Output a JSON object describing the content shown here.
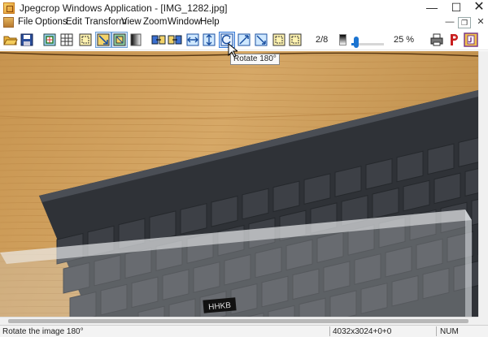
{
  "window": {
    "title": "Jpegcrop Windows Application - [IMG_1282.jpg]",
    "minimize_glyph": "—",
    "maximize_glyph": "☐",
    "close_glyph": "✕"
  },
  "menu": {
    "items": [
      "File",
      "Options",
      "Edit",
      "Transform",
      "View",
      "Zoom",
      "Window",
      "Help"
    ],
    "mdi_minimize_glyph": "—",
    "mdi_restore_glyph": "❐",
    "mdi_close_glyph": "✕"
  },
  "toolbar": {
    "buttons": [
      {
        "icon": "open-folder-icon",
        "pressed": false
      },
      {
        "icon": "save-icon",
        "pressed": false
      },
      {
        "icon": "crop-icon",
        "pressed": false
      },
      {
        "icon": "grid-icon",
        "pressed": false
      },
      {
        "icon": "select-icon",
        "pressed": false
      },
      {
        "icon": "fit-icon",
        "pressed": true
      },
      {
        "icon": "fit-alt-icon",
        "pressed": true
      },
      {
        "icon": "gradient-icon",
        "pressed": false
      },
      {
        "icon": "transform-icon",
        "pressed": false
      },
      {
        "icon": "transform-alt-icon",
        "pressed": false
      },
      {
        "icon": "flip-horizontal-icon",
        "pressed": false
      },
      {
        "icon": "flip-vertical-icon",
        "pressed": false
      },
      {
        "icon": "rotate-180-icon",
        "pressed": false,
        "hover": true
      },
      {
        "icon": "rotate-90-icon",
        "pressed": false
      },
      {
        "icon": "transpose-icon",
        "pressed": false
      },
      {
        "icon": "marquee-icon",
        "pressed": false
      },
      {
        "icon": "marquee-alt-icon",
        "pressed": false
      },
      {
        "icon": "print-icon",
        "pressed": false
      },
      {
        "icon": "p-letter-icon",
        "pressed": false
      },
      {
        "icon": "about-icon",
        "pressed": false
      }
    ],
    "page_indicator": "2/8",
    "zoom_label": "25 %",
    "zoom_level": 0.08,
    "tooltip": "Rotate 180°"
  },
  "image": {
    "filename": "IMG_1282.jpg",
    "description_alt": "photo",
    "case_label": "HHKB"
  },
  "status": {
    "message": "Rotate the image 180°",
    "dimensions": "4032x3024+0+0",
    "num_lock": "NUM"
  },
  "colors": {
    "accent": "#1b74d1",
    "wood": "#c99a56",
    "keyboard": "#3a3d42"
  }
}
